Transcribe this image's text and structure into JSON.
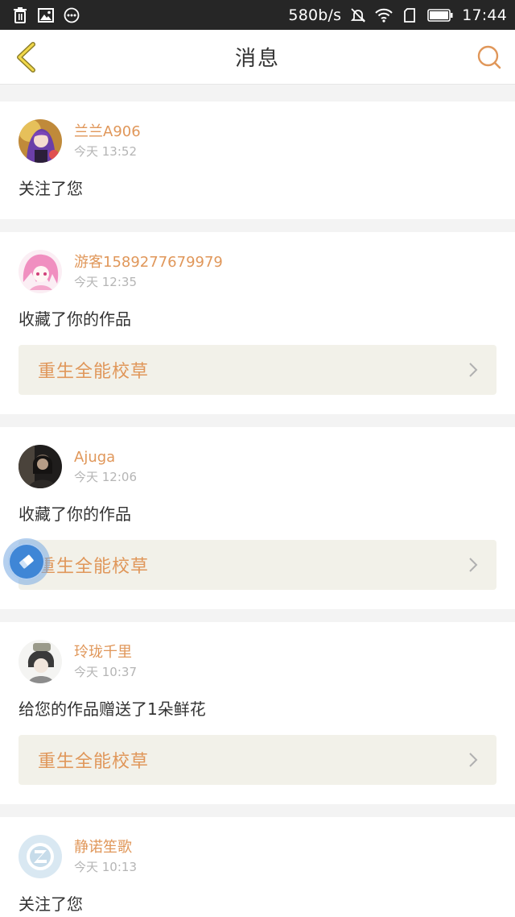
{
  "status_bar": {
    "speed": "580b/s",
    "time": "17:44",
    "icons": [
      "trash-icon",
      "image-icon",
      "more-dots-icon",
      "mute-icon",
      "wifi-icon",
      "sim-icon",
      "battery-icon"
    ]
  },
  "nav": {
    "title": "消息",
    "back_icon": "back-chevron-icon",
    "search_icon": "search-icon",
    "accent": "#e0975a"
  },
  "messages": [
    {
      "name": "兰兰A906",
      "time": "今天 13:52",
      "action": "关注了您",
      "avatar": "anime-purple-avatar"
    },
    {
      "name": "游客1589277679979",
      "time": "今天 12:35",
      "action": "收藏了你的作品",
      "work": "重生全能校草",
      "avatar": "anime-pink-avatar"
    },
    {
      "name": "Ajuga",
      "time": "今天 12:06",
      "action": "收藏了你的作品",
      "work": "重生全能校草",
      "avatar": "dark-photo-avatar"
    },
    {
      "name": "玲珑千里",
      "time": "今天 10:37",
      "action": "给您的作品赠送了1朵鲜花",
      "work": "重生全能校草",
      "avatar": "sketch-avatar"
    },
    {
      "name": "静诺笙歌",
      "time": "今天 10:13",
      "action": "关注了您",
      "avatar": "default-qq-avatar"
    }
  ]
}
